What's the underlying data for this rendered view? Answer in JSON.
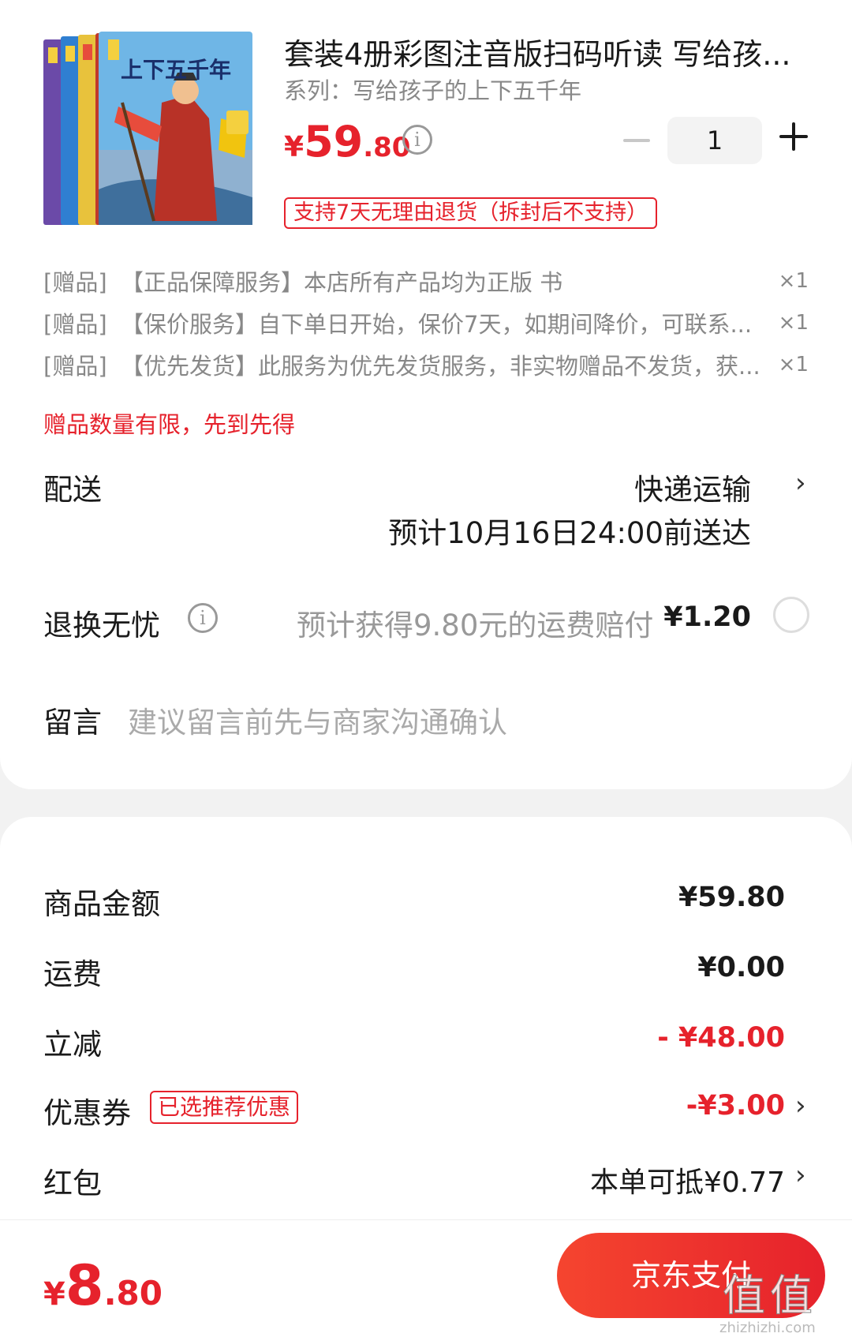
{
  "product": {
    "cover_title": "上下五千年",
    "title": "套装4册彩图注音版扫码听读 写给孩...",
    "series": "系列：写给孩子的上下五千年",
    "price_yen": "¥",
    "price_int": "59",
    "price_dec": ".80",
    "quantity": "1",
    "return_policy": "支持7天无理由退货（拆封后不支持）"
  },
  "gifts": [
    {
      "tag": "[赠品]",
      "text": "【正品保障服务】本店所有产品均为正版 书",
      "qty": "×1"
    },
    {
      "tag": "[赠品]",
      "text": "【保价服务】自下单日开始，保价7天，如期间降价，可联系...",
      "qty": "×1"
    },
    {
      "tag": "[赠品]",
      "text": "【优先发货】此服务为优先发货服务，非实物赠品不发货，获...",
      "qty": "×1"
    }
  ],
  "gift_limit": "赠品数量有限，先到先得",
  "delivery": {
    "label": "配送",
    "method": "快递运输",
    "eta": "预计10月16日24:00前送达"
  },
  "return_worry_free": {
    "label": "退换无忧",
    "desc": "预计获得9.80元的运费赔付",
    "price": "¥1.20"
  },
  "message": {
    "label": "留言",
    "placeholder": "建议留言前先与商家沟通确认"
  },
  "summary": {
    "goods_label": "商品金额",
    "goods_value": "¥59.80",
    "shipping_label": "运费",
    "shipping_value": "¥0.00",
    "discount_label": "立减",
    "discount_value": "- ¥48.00",
    "coupon_label": "优惠券",
    "coupon_tag": "已选推荐优惠",
    "coupon_value": "-¥3.00",
    "redpacket_label": "红包",
    "redpacket_value": "本单可抵¥0.77"
  },
  "footer": {
    "total_yen": "¥",
    "total_int": "8",
    "total_dec": ".80",
    "pay_label": "京东支付",
    "watermark": "值",
    "watermark_site": "zhizhizhi.com"
  },
  "colors": {
    "accent_red": "#e6222c",
    "text_dark": "#1a1a1a",
    "text_muted": "#888888"
  }
}
